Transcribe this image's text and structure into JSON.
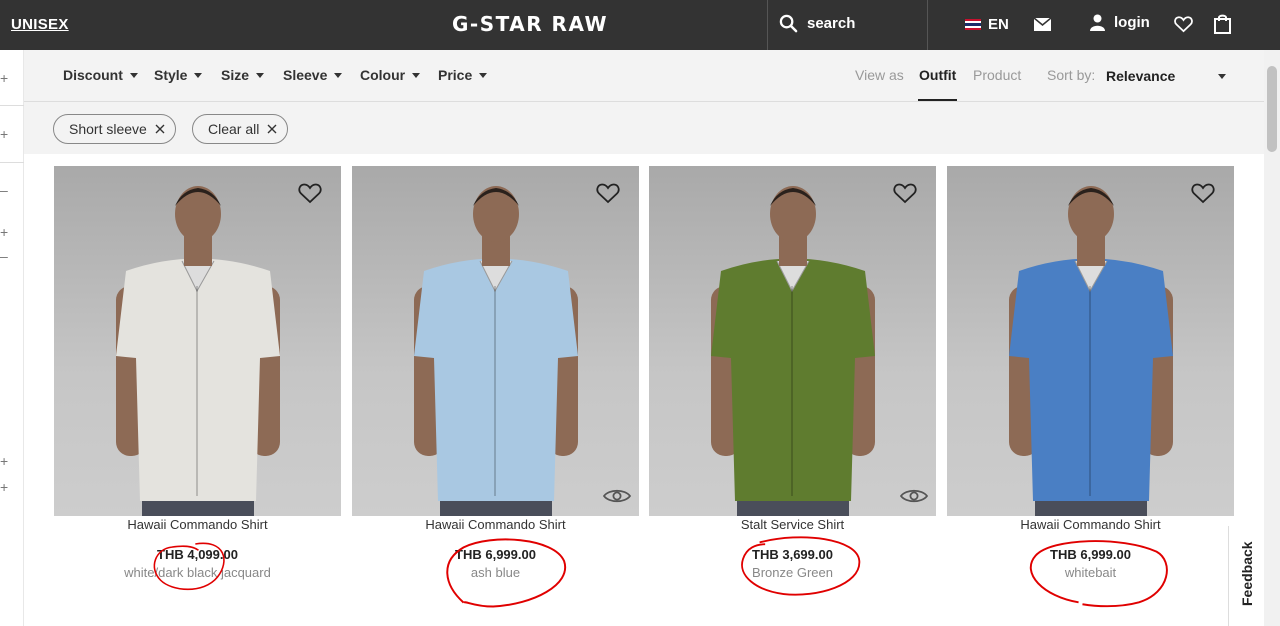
{
  "header": {
    "segment_label": "UNISEX",
    "brand": "G-STAR RAW",
    "search_label": "search",
    "language": "EN",
    "login_label": "login",
    "icons": [
      "search-icon",
      "flag-icon",
      "mail-icon",
      "user-icon",
      "heart-icon",
      "bag-icon"
    ]
  },
  "filters": {
    "items": [
      "Discount",
      "Style",
      "Size",
      "Sleeve",
      "Colour",
      "Price"
    ],
    "view_as_label": "View as",
    "view_options": [
      "Outfit",
      "Product"
    ],
    "active_view": "Outfit",
    "sort_label": "Sort by:",
    "sort_value": "Relevance"
  },
  "active_filters": {
    "chips": [
      "Short sleeve",
      "Clear all"
    ]
  },
  "products": [
    {
      "name": "Hawaii Commando Shirt",
      "price": "THB 4,099.00",
      "colour": "white/dark black jacquard",
      "shirt_color": "#e4e3de",
      "has_eye_icon": false
    },
    {
      "name": "Hawaii Commando Shirt",
      "price": "THB 6,999.00",
      "colour": "ash blue",
      "shirt_color": "#a9c8e2",
      "has_eye_icon": true
    },
    {
      "name": "Stalt Service Shirt",
      "price": "THB 3,699.00",
      "colour": "Bronze Green",
      "shirt_color": "#5f7c2f",
      "has_eye_icon": true
    },
    {
      "name": "Hawaii Commando Shirt",
      "price": "THB 6,999.00",
      "colour": "whitebait",
      "shirt_color": "#4a7fc4",
      "has_eye_icon": false
    }
  ],
  "feedback_label": "Feedback",
  "colors": {
    "header_bg": "#333333",
    "annotation_red": "#e00000"
  }
}
